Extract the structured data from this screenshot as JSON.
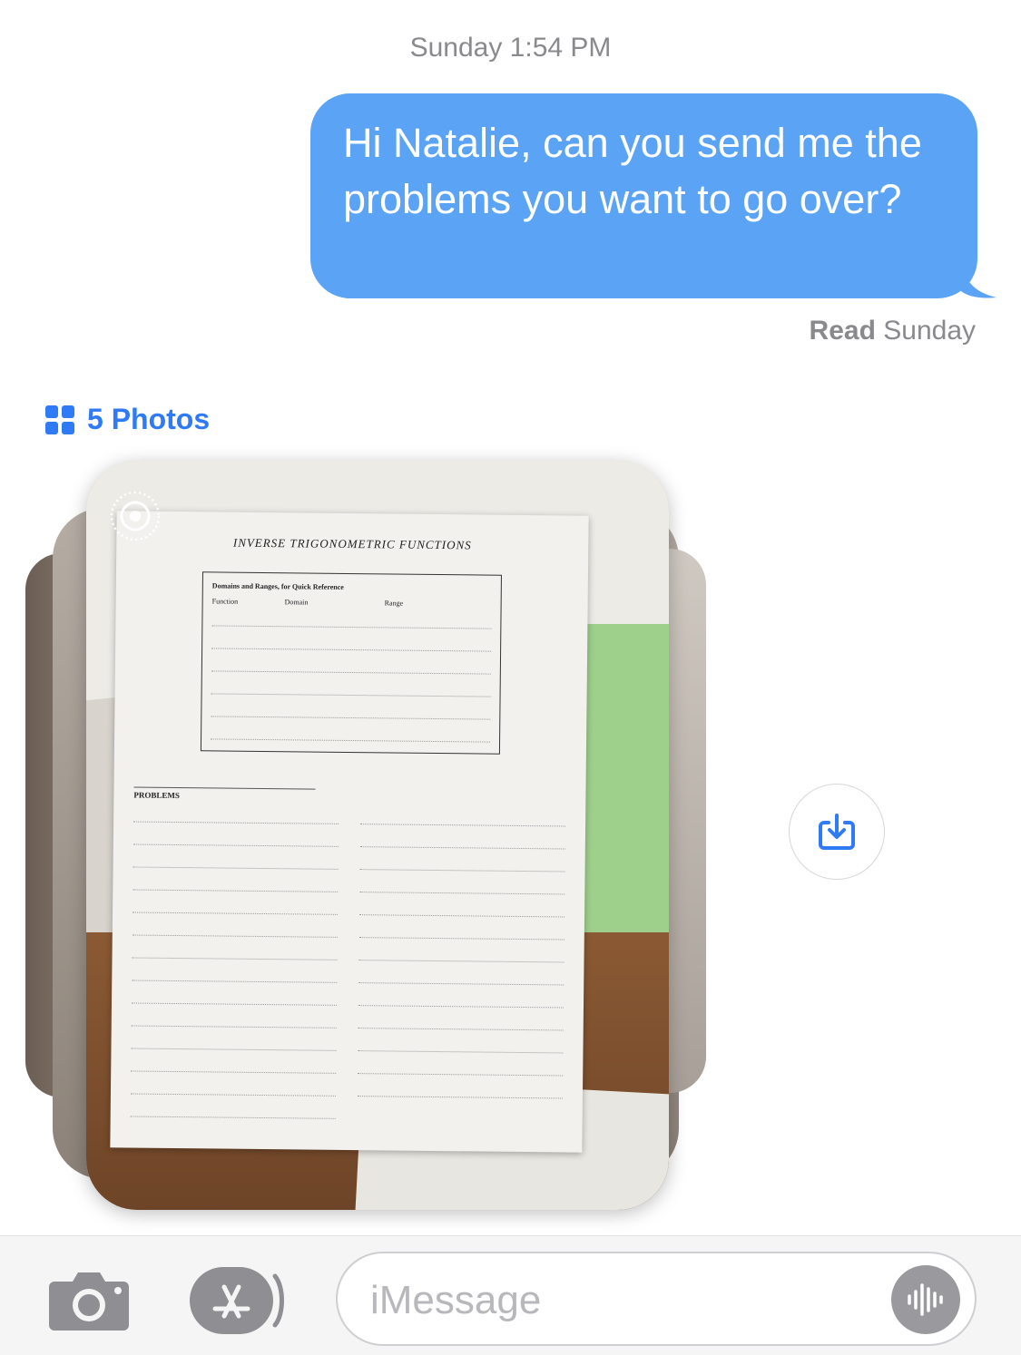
{
  "conversation": {
    "timestamp": "Sunday 1:54 PM",
    "messages": [
      {
        "text": "Hi Natalie, can you send me the problems you want to go over?",
        "color": "#5ba3f5"
      }
    ],
    "read_status": {
      "label": "Read",
      "day": "Sunday"
    },
    "attachment": {
      "label": "5 Photos",
      "photo_icon": "grid-icon",
      "live_icon": "live-photo-icon",
      "document": {
        "title": "INVERSE TRIGONOMETRIC FUNCTIONS",
        "box_title": "Domains and Ranges, for Quick Reference",
        "box_headers": [
          "Function",
          "Domain",
          "Range"
        ],
        "problems_title": "PROBLEMS"
      }
    },
    "save_icon": "save-to-photos-icon"
  },
  "toolbar": {
    "camera_icon": "camera-icon",
    "apps_icon": "app-store-icon",
    "input_placeholder": "iMessage",
    "mic_icon": "audio-waveform-icon"
  },
  "colors": {
    "accent": "#2f7bf6",
    "bubble": "#5ba3f5",
    "secondary_text": "#8a8a8e"
  }
}
